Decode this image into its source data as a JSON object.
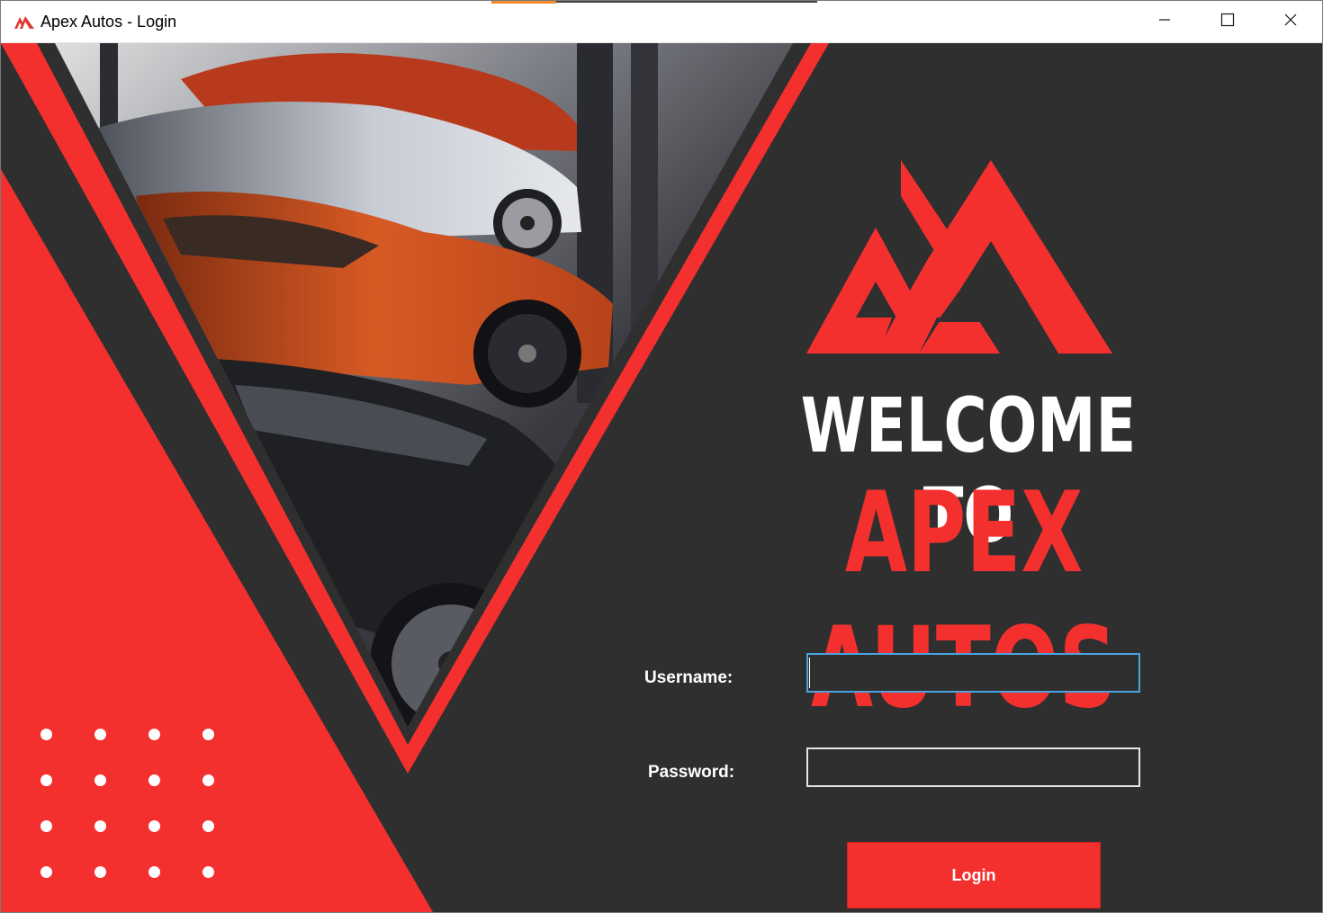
{
  "window": {
    "title": "Apex Autos - Login",
    "controls": {
      "minimize": "—",
      "maximize": "☐",
      "close": "✕"
    }
  },
  "hero": {
    "line1": "WELCOME TO",
    "line2": "APEX AUTOS"
  },
  "form": {
    "username_label": "Username:",
    "username_value": "",
    "password_label": "Password:",
    "password_value": "",
    "login_label": "Login"
  },
  "colors": {
    "accent": "#f4302f",
    "background": "#2f2f2f",
    "text": "#ffffff"
  },
  "icons": [
    "apex-logo-icon",
    "minimize-icon",
    "maximize-icon",
    "close-icon"
  ]
}
